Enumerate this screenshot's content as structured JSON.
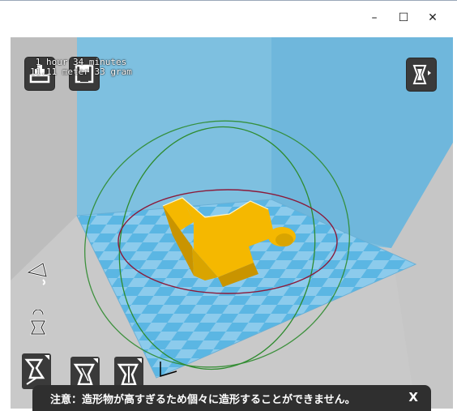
{
  "window": {
    "minimize_glyph": "–",
    "maximize_glyph": "☐",
    "close_glyph": "✕"
  },
  "toolbar": {
    "load_icon": "load-model-icon",
    "save_icon": "save-icon",
    "view_mode_icon": "view-mode-icon"
  },
  "print_info": {
    "time": "1 hour 34 minutes",
    "material": "11.11 meter 33 gram"
  },
  "tools": {
    "rotate_icon": "rotate-tool-icon",
    "scale_icon": "scale-tool-icon",
    "mirror_icon": "mirror-tool-icon",
    "bottom_left_icon": "tool-icon",
    "bottom_mid1_icon": "tool-icon",
    "bottom_mid2_icon": "tool-icon"
  },
  "notice": {
    "text": "注意：造形物が高すぎるため個々に造形することができません。",
    "close": "X"
  },
  "colors": {
    "back_wall": "#7ec0e0",
    "floor_blue": "#5bb6e3",
    "floor_light": "#8ccbec",
    "model": "#f5b800",
    "toolbar_bg": "#3a3a3a"
  }
}
